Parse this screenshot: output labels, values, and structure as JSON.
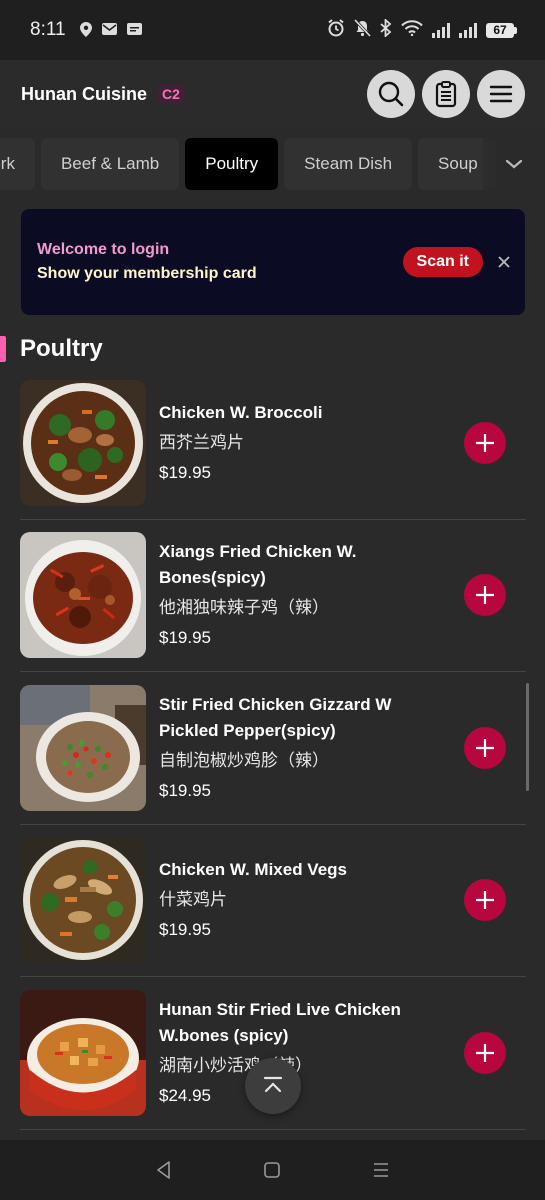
{
  "status_bar": {
    "time": "8:11",
    "battery": "67"
  },
  "header": {
    "restaurant_name": "Hunan Cuisine",
    "store_badge": "C2",
    "actions": [
      "search-icon",
      "clipboard-icon",
      "menu-icon"
    ]
  },
  "category_tabs": [
    {
      "label": "Pork",
      "active": false
    },
    {
      "label": "Beef & Lamb",
      "active": false
    },
    {
      "label": "Poultry",
      "active": true
    },
    {
      "label": "Steam Dish",
      "active": false
    },
    {
      "label": "Soup",
      "active": false
    }
  ],
  "banner": {
    "line1": "Welcome to login",
    "line2": "Show your membership card",
    "button_label": "Scan it"
  },
  "section": {
    "title": "Poultry"
  },
  "menu_items": [
    {
      "name": "Chicken W. Broccoli",
      "name_cn": "西芥兰鸡片",
      "price": "$19.95"
    },
    {
      "name": "Xiangs Fried Chicken W. Bones(spicy)",
      "name_cn": "他湘独味辣子鸡（辣）",
      "price": "$19.95"
    },
    {
      "name": "Stir Fried Chicken Gizzard W Pickled Pepper(spicy)",
      "name_cn": "自制泡椒炒鸡胗（辣）",
      "price": "$19.95"
    },
    {
      "name": "Chicken W. Mixed Vegs",
      "name_cn": "什菜鸡片",
      "price": "$19.95"
    },
    {
      "name": "Hunan Stir Fried Live Chicken W.bones (spicy)",
      "name_cn": "湖南小炒活鸡（辣）",
      "price": "$24.95"
    }
  ],
  "colors": {
    "accent": "#b8063f",
    "badge_text": "#ff6fb5",
    "banner_bg": "#0b0c24",
    "scan_button": "#c1121f"
  }
}
